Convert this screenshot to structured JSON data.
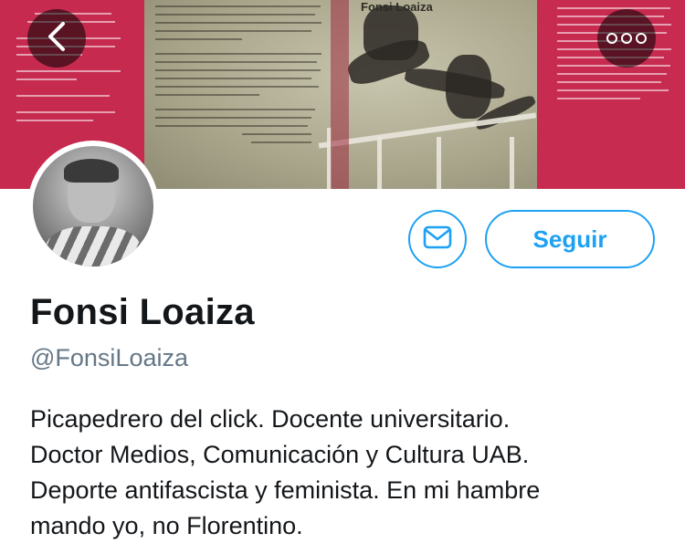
{
  "header": {
    "back_icon": "chevron-left-icon",
    "more_icon": "more-horizontal-icon",
    "banner_book_title": "Fonsi Loaiza"
  },
  "profile": {
    "name": "Fonsi Loaiza",
    "handle": "@FonsiLoaiza",
    "bio_lines": [
      "Picapedrero del click. Docente universitario.",
      "Doctor Medios, Comunicación y Cultura UAB.",
      "Deporte antifascista y feminista. En mi hambre",
      "mando yo, no Florentino."
    ]
  },
  "actions": {
    "message_icon": "envelope-icon",
    "follow_label": "Seguir"
  },
  "colors": {
    "accent": "#1da1f2",
    "name": "#14171a",
    "handle": "#657786",
    "banner_red": "#c72b50"
  }
}
